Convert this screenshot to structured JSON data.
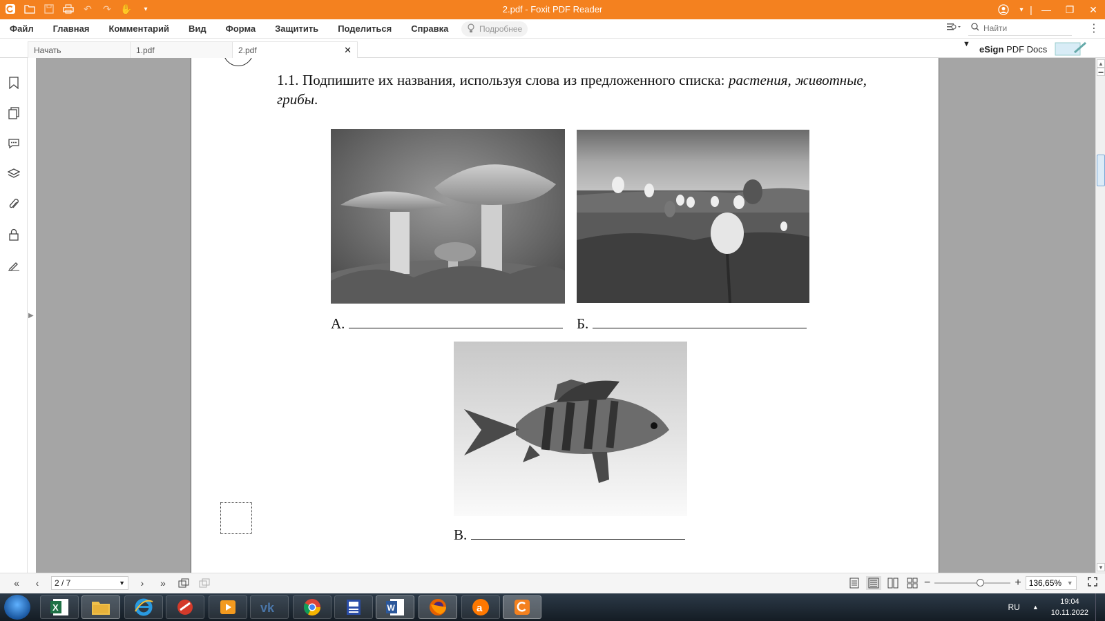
{
  "window": {
    "title": "2.pdf - Foxit PDF Reader"
  },
  "menu": {
    "items": [
      "Файл",
      "Главная",
      "Комментарий",
      "Вид",
      "Форма",
      "Защитить",
      "Поделиться",
      "Справка"
    ],
    "help_placeholder": "Подробнее",
    "search_placeholder": "Найти"
  },
  "tabs": [
    {
      "label": "Начать"
    },
    {
      "label": "1.pdf"
    },
    {
      "label": "2.pdf",
      "active": true
    }
  ],
  "esign": {
    "bold": "eSign",
    "rest": "PDF Docs"
  },
  "document": {
    "question_number": "1.1.",
    "question_text": "Подпишите их названия, используя слова из предложенного списка: ",
    "question_words": "растения, животные, грибы",
    "question_end": ".",
    "labels": {
      "a": "А.",
      "b": "Б.",
      "c": "В."
    }
  },
  "statusbar": {
    "page_display": "2 / 7",
    "zoom": "136,65%",
    "zoom_fraction": 0.6
  },
  "taskbar": {
    "apps": [
      "excel-icon",
      "file-explorer-icon",
      "internet-explorer-icon",
      "app-icon",
      "media-player-icon",
      "vk-icon",
      "chrome-icon",
      "app-icon",
      "word-icon",
      "firefox-icon",
      "avast-icon",
      "foxit-reader-icon"
    ],
    "language": "RU",
    "time": "19:04",
    "date": "10.11.2022"
  },
  "colors": {
    "accent": "#f4811f",
    "canvas": "#a5a5a5"
  }
}
